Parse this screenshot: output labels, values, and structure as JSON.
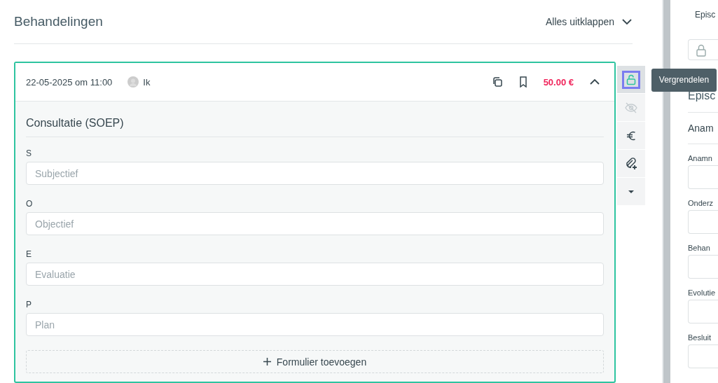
{
  "header": {
    "title": "Behandelingen",
    "expand_all": "Alles uitklappen"
  },
  "treatment": {
    "date": "22-05-2025 om 11:00",
    "user": "Ik",
    "price": "50.00 €",
    "expanded": true,
    "form_title": "Consultatie (SOEP)",
    "fields": [
      {
        "label": "S",
        "placeholder": "Subjectief"
      },
      {
        "label": "O",
        "placeholder": "Objectief"
      },
      {
        "label": "E",
        "placeholder": "Evaluatie"
      },
      {
        "label": "P",
        "placeholder": "Plan"
      }
    ],
    "add_form": "Formulier toevoegen"
  },
  "side_toolbar": [
    {
      "kind": "lock",
      "selected": true,
      "disabled": false
    },
    {
      "kind": "hide",
      "selected": false,
      "disabled": true
    },
    {
      "kind": "euro",
      "selected": false,
      "disabled": false
    },
    {
      "kind": "attach",
      "selected": false,
      "disabled": false
    },
    {
      "kind": "more",
      "selected": false,
      "disabled": false
    }
  ],
  "tooltip": "Vergrendelen",
  "right_panel": {
    "tab": "Episc",
    "title": "Episc",
    "section": "Anam",
    "fields": [
      {
        "label": "Anamn"
      },
      {
        "label": "Onderz"
      },
      {
        "label": "Behan"
      },
      {
        "label": "Evolutie"
      },
      {
        "label": "Besluit"
      }
    ]
  }
}
